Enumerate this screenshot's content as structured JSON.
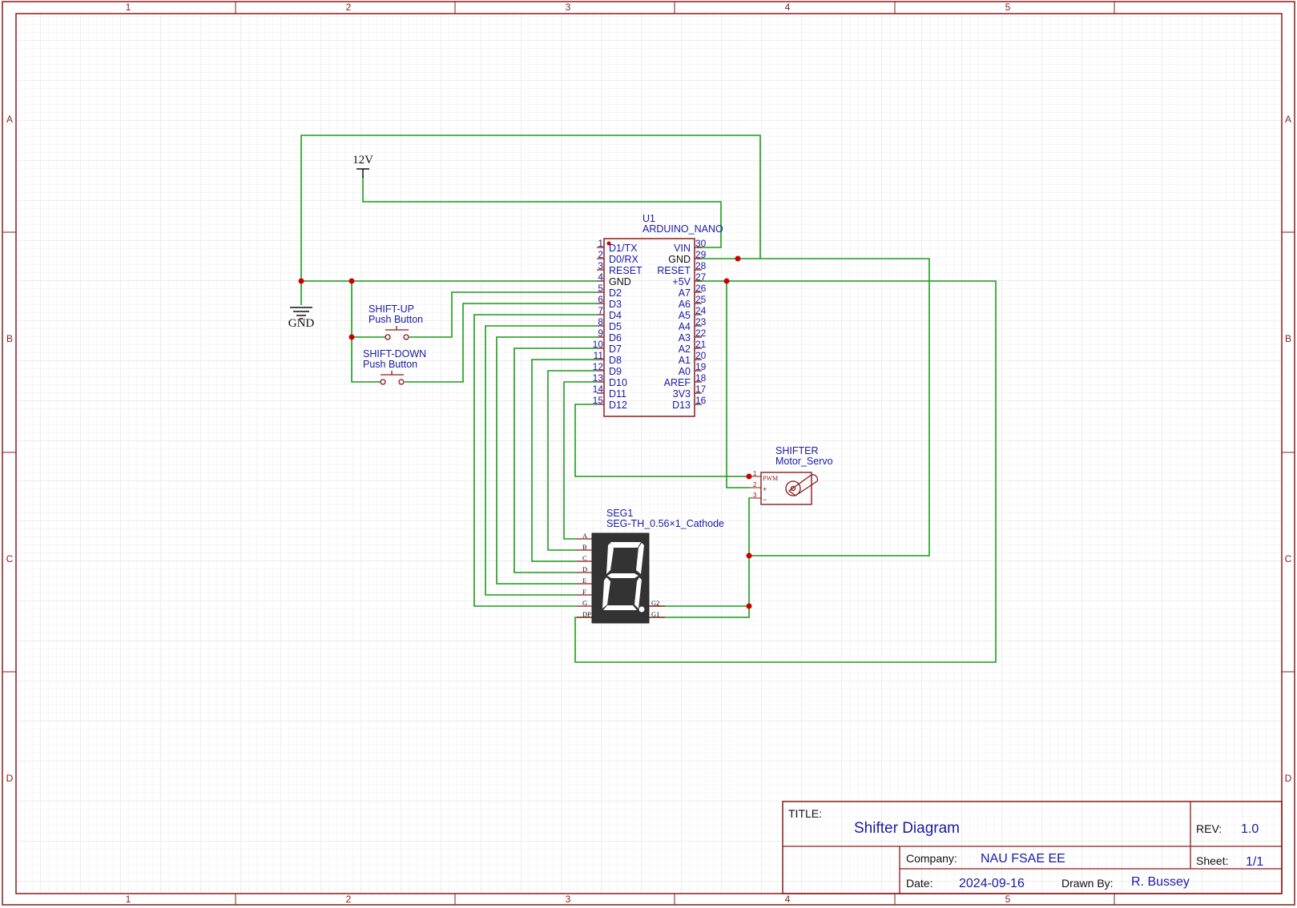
{
  "title_block": {
    "title_label": "TITLE:",
    "title": "Shifter Diagram",
    "rev_label": "REV:",
    "rev": "1.0",
    "company_label": "Company:",
    "company": "NAU FSAE EE",
    "sheet_label": "Sheet:",
    "sheet": "1/1",
    "date_label": "Date:",
    "date": "2024-09-16",
    "drawn_by_label": "Drawn By:",
    "drawn_by": "R. Bussey"
  },
  "frame": {
    "columns": [
      "1",
      "2",
      "3",
      "4",
      "5"
    ],
    "rows": [
      "A",
      "B",
      "C",
      "D"
    ]
  },
  "power": {
    "v12": "12V",
    "gnd": "GND"
  },
  "arduino": {
    "ref": "U1",
    "part": "ARDUINO_NANO",
    "left_pins": [
      {
        "num": "1",
        "name": "D1/TX"
      },
      {
        "num": "2",
        "name": "D0/RX"
      },
      {
        "num": "3",
        "name": "RESET"
      },
      {
        "num": "4",
        "name": "GND"
      },
      {
        "num": "5",
        "name": "D2"
      },
      {
        "num": "6",
        "name": "D3"
      },
      {
        "num": "7",
        "name": "D4"
      },
      {
        "num": "8",
        "name": "D5"
      },
      {
        "num": "9",
        "name": "D6"
      },
      {
        "num": "10",
        "name": "D7"
      },
      {
        "num": "11",
        "name": "D8"
      },
      {
        "num": "12",
        "name": "D9"
      },
      {
        "num": "13",
        "name": "D10"
      },
      {
        "num": "14",
        "name": "D11"
      },
      {
        "num": "15",
        "name": "D12"
      }
    ],
    "right_pins": [
      {
        "num": "30",
        "name": "VIN"
      },
      {
        "num": "29",
        "name": "GND"
      },
      {
        "num": "28",
        "name": "RESET"
      },
      {
        "num": "27",
        "name": "+5V"
      },
      {
        "num": "26",
        "name": "A7"
      },
      {
        "num": "25",
        "name": "A6"
      },
      {
        "num": "24",
        "name": "A5"
      },
      {
        "num": "23",
        "name": "A4"
      },
      {
        "num": "22",
        "name": "A3"
      },
      {
        "num": "21",
        "name": "A2"
      },
      {
        "num": "20",
        "name": "A1"
      },
      {
        "num": "19",
        "name": "A0"
      },
      {
        "num": "18",
        "name": "AREF"
      },
      {
        "num": "17",
        "name": "3V3"
      },
      {
        "num": "16",
        "name": "D13"
      }
    ]
  },
  "shift_up": {
    "ref": "SHIFT-UP",
    "part": "Push Button"
  },
  "shift_down": {
    "ref": "SHIFT-DOWN",
    "part": "Push Button"
  },
  "servo": {
    "ref": "SHIFTER",
    "part": "Motor_Servo",
    "pins": [
      "1",
      "2",
      "3"
    ],
    "pin_labels": [
      "PWM",
      "+",
      "−"
    ]
  },
  "seg": {
    "ref": "SEG1",
    "part": "SEG-TH_0.56×1_Cathode",
    "left_pins": [
      "A",
      "B",
      "C",
      "D",
      "E",
      "F",
      "G",
      "DP"
    ],
    "right_pins": [
      "G2",
      "G1"
    ]
  },
  "colors": {
    "wire": "#1a9c1a",
    "component": "#8b1a1a",
    "label": "#1a1aa6",
    "junction": "#cc0000"
  }
}
